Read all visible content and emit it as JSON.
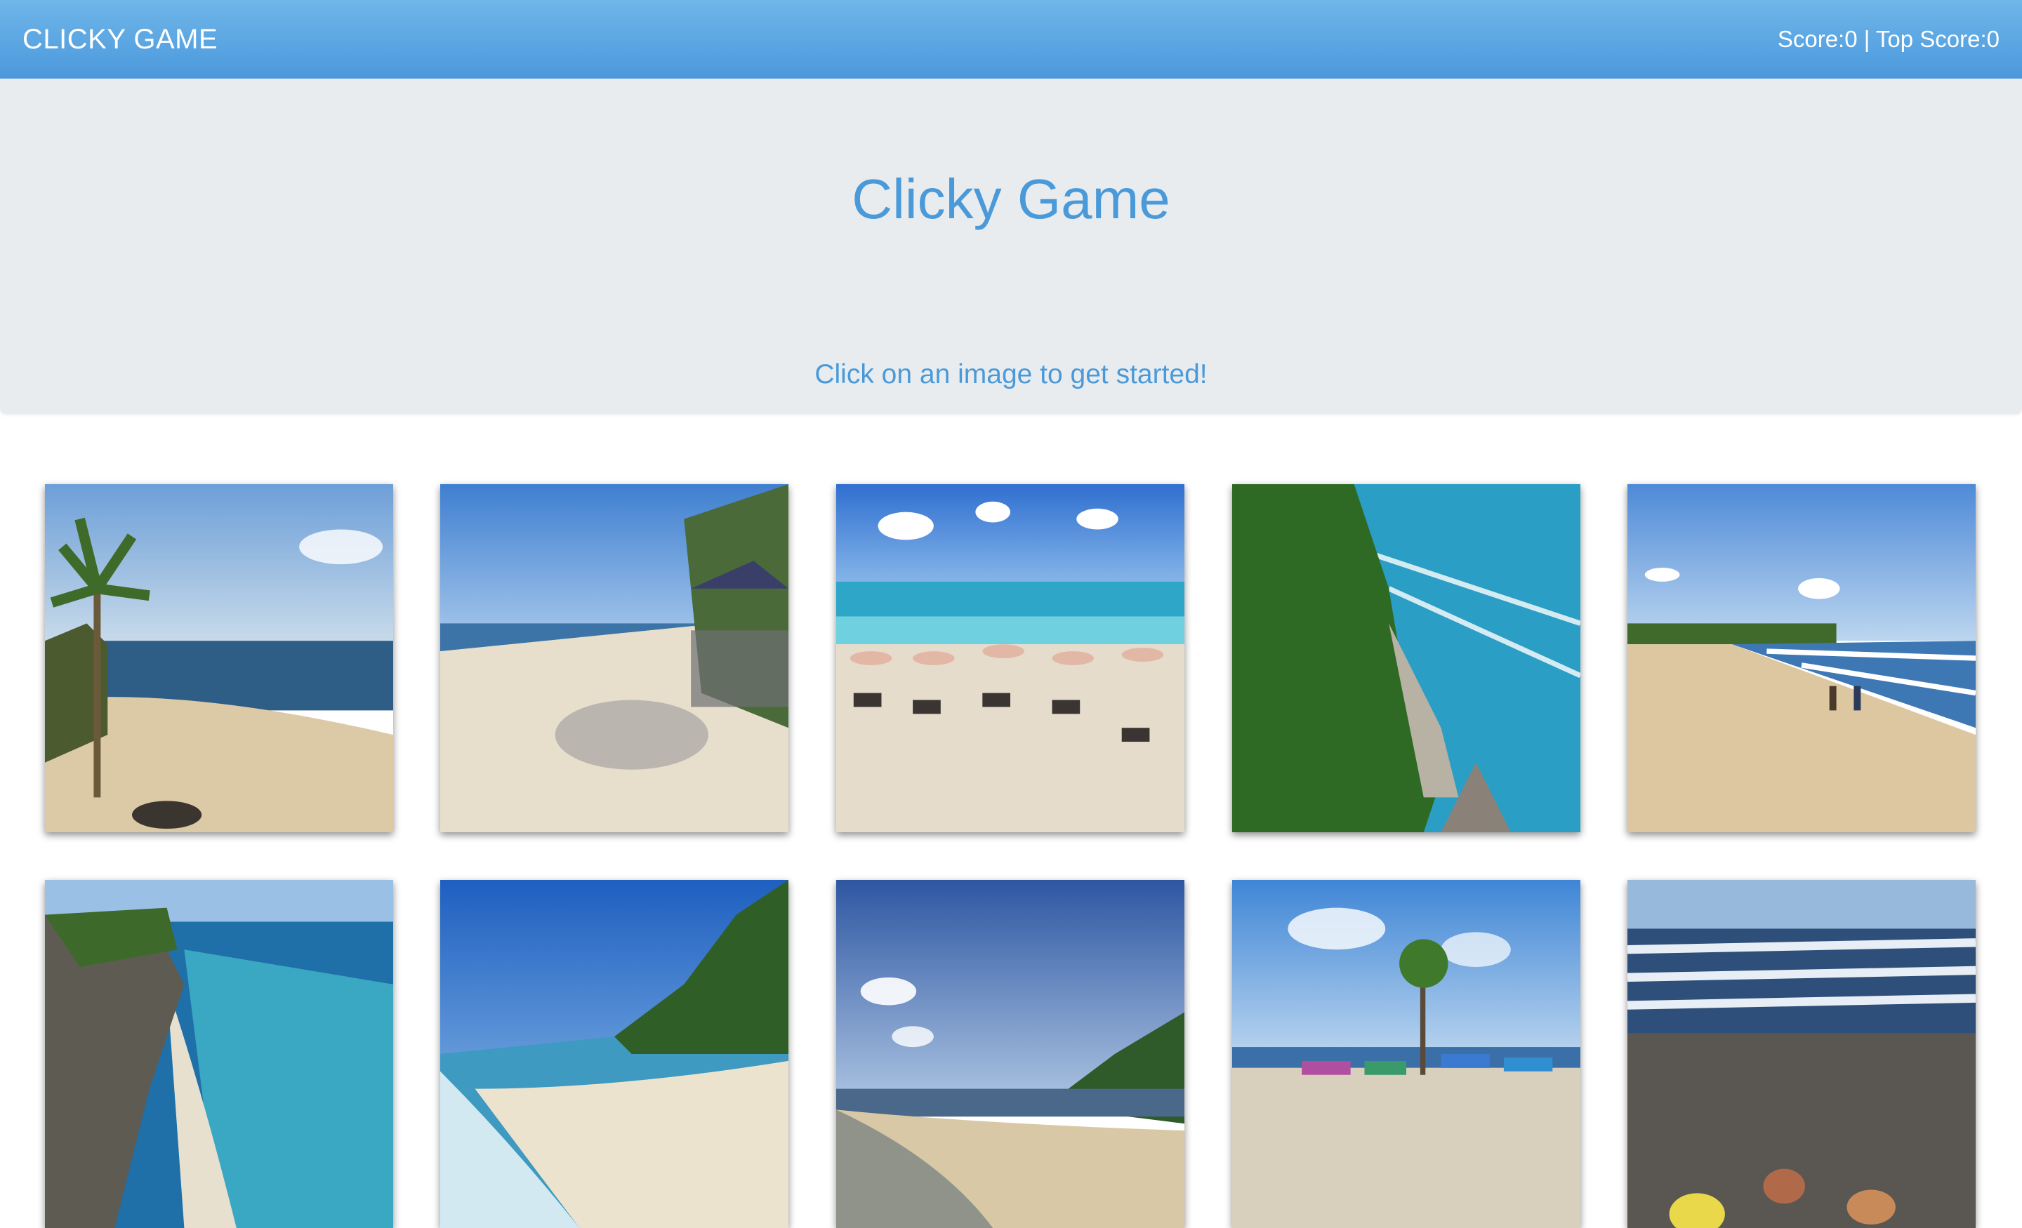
{
  "navbar": {
    "brand": "CLICKY GAME",
    "score_text": "Score:0 | Top Score:0"
  },
  "header": {
    "title": "Clicky Game",
    "subtitle": "Click on an image to get started!"
  },
  "images": [
    {
      "icon": "beach-palm-image"
    },
    {
      "icon": "beach-umbrellas-shade-image"
    },
    {
      "icon": "beach-loungers-image"
    },
    {
      "icon": "coastal-cliff-image"
    },
    {
      "icon": "beach-people-waves-image"
    },
    {
      "icon": "cliff-shore-aerial-image"
    },
    {
      "icon": "tropical-shore-image"
    },
    {
      "icon": "wide-sandy-beach-image"
    },
    {
      "icon": "boats-on-beach-image"
    },
    {
      "icon": "surf-beach-image"
    }
  ]
}
